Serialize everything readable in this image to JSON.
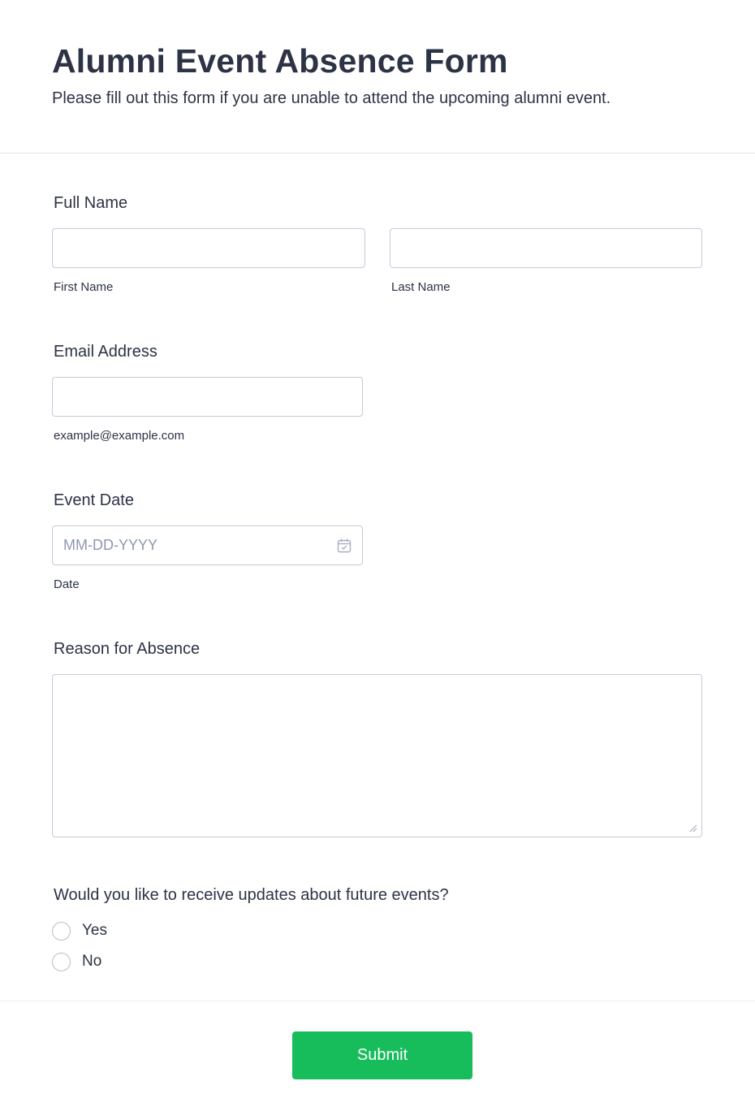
{
  "form": {
    "title": "Alumni Event Absence Form",
    "subtitle": "Please fill out this form if you are unable to attend the upcoming alumni event."
  },
  "full_name": {
    "label": "Full Name",
    "first_name": {
      "value": "",
      "sublabel": "First Name"
    },
    "last_name": {
      "value": "",
      "sublabel": "Last Name"
    }
  },
  "email": {
    "label": "Email Address",
    "value": "",
    "sublabel": "example@example.com"
  },
  "event_date": {
    "label": "Event Date",
    "placeholder": "MM-DD-YYYY",
    "sublabel": "Date",
    "icon": "calendar-icon"
  },
  "reason": {
    "label": "Reason for Absence",
    "value": ""
  },
  "updates": {
    "question": "Would you like to receive updates about future events?",
    "options": [
      {
        "label": "Yes",
        "selected": false
      },
      {
        "label": "No",
        "selected": false
      }
    ]
  },
  "submit": {
    "label": "Submit"
  },
  "colors": {
    "text": "#2c3345",
    "border": "#c3cad8",
    "submit_bg": "#18bd5b",
    "placeholder": "#8d99ae"
  }
}
